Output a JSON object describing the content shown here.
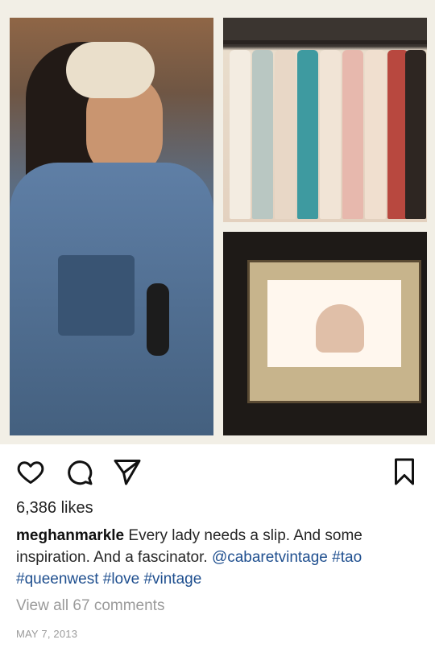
{
  "post": {
    "images": [
      {
        "name": "portrait-photo",
        "description_icon": "photo"
      },
      {
        "name": "clothing-rack-photo",
        "description_icon": "photo"
      },
      {
        "name": "framed-picture-photo",
        "description_icon": "photo"
      }
    ],
    "actions": {
      "like_icon": "heart-icon",
      "comment_icon": "comment-icon",
      "share_icon": "send-icon",
      "save_icon": "bookmark-icon"
    },
    "likes_text": "6,386 likes",
    "caption": {
      "username": "meghanmarkle",
      "text": " Every lady needs a slip. And some inspiration. And a fascinator. ",
      "mention": "@cabaretvintage",
      "hashtags": [
        "#tao",
        "#queenwest",
        "#love",
        "#vintage"
      ]
    },
    "view_comments_text": "View all 67 comments",
    "date_text": "MAY 7, 2013"
  },
  "colors": {
    "link": "#1f4f8f",
    "muted": "#9a9a9a",
    "text": "#262626"
  }
}
